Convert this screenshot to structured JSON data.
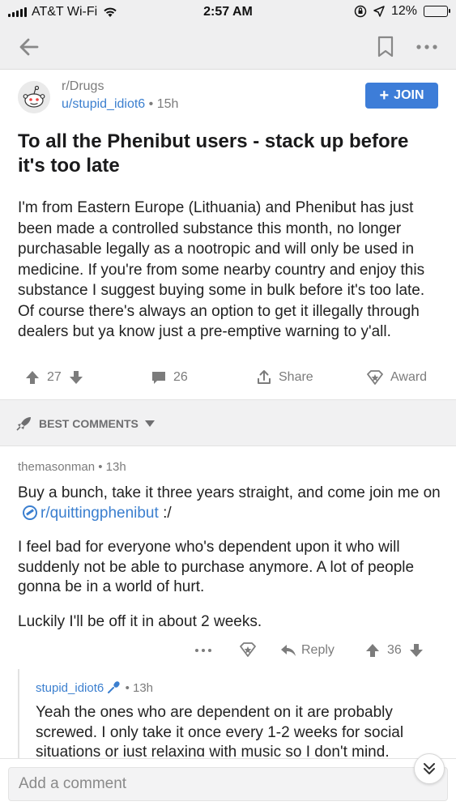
{
  "status_bar": {
    "carrier": "AT&T Wi-Fi",
    "time": "2:57 AM",
    "battery": "12%",
    "battery_level": 0.12,
    "battery_color": "#f2c200"
  },
  "nav": {
    "back_icon": "arrow-left-icon",
    "bookmark_icon": "bookmark-icon",
    "more_icon": "more-horizontal-icon"
  },
  "post": {
    "subreddit": "r/Drugs",
    "author": "u/stupid_idiot6",
    "age": "15h",
    "join_label": "JOIN",
    "title": "To all the Phenibut users - stack up before it's too late",
    "body": "I'm from Eastern Europe (Lithuania) and Phenibut has just been made a controlled substance this month, no longer purchasable legally as a nootropic and will only be used in medicine. If you're from some nearby country and enjoy this substance I suggest buying some in bulk before it's too late. Of course there's always an option to get it illegally through dealers but ya know just a pre-emptive warning to y'all.",
    "votes": "27",
    "comments": "26",
    "share_label": "Share",
    "award_label": "Award"
  },
  "sort": {
    "label": "BEST COMMENTS"
  },
  "comments": [
    {
      "author": "themasonman",
      "age": "13h",
      "paragraph1_before": "Buy a bunch, take it three years straight, and come join me on",
      "link": "r/quittingphenibut",
      "paragraph1_after": ":/",
      "paragraph2": "I feel bad for everyone who's dependent upon it who will suddenly not be able to purchase anymore. A lot of people gonna be in a world of hurt.",
      "paragraph3": "Luckily I'll be off it in about 2 weeks.",
      "reply_label": "Reply",
      "votes": "36"
    },
    {
      "author": "stupid_idiot6",
      "age": "13h",
      "text": "Yeah the ones who are dependent on it are probably screwed. I only take it once every 1-2 weeks for social situations or just relaxing with music so I don't mind."
    }
  ],
  "composer": {
    "placeholder": "Add a comment"
  },
  "colors": {
    "accent": "#3d7dd8",
    "link": "#3b7fcf"
  }
}
